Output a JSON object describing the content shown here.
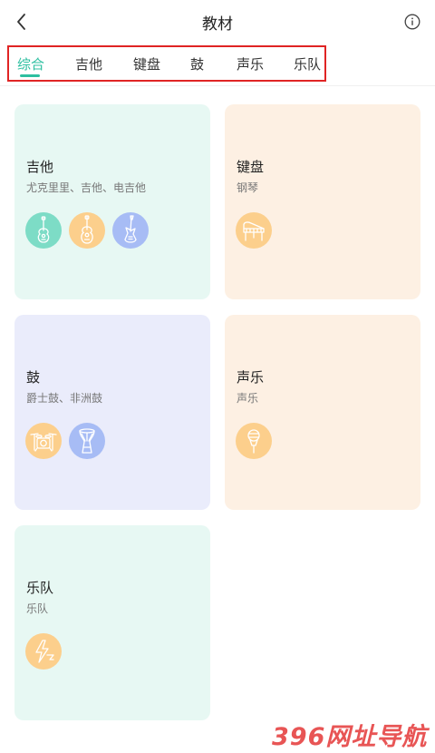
{
  "header": {
    "title": "教材",
    "back_icon": "chevron-left-icon",
    "info_icon": "info-circle-icon"
  },
  "tabs": [
    {
      "label": "综合",
      "active": true
    },
    {
      "label": "吉他",
      "active": false
    },
    {
      "label": "键盘",
      "active": false
    },
    {
      "label": "鼓",
      "active": false
    },
    {
      "label": "声乐",
      "active": false
    },
    {
      "label": "乐队",
      "active": false
    }
  ],
  "colors": {
    "accent": "#2dbfa0",
    "highlight_border": "#e02424",
    "mint_card": "#e7f8f3",
    "peach_card": "#fdf0e3",
    "lavender_card": "#eaecfb",
    "teal_icon": "#7ddcc6",
    "orange_icon": "#fccf8c",
    "blue_icon": "#a7bcf5"
  },
  "cards": [
    {
      "title": "吉他",
      "subtitle": "尤克里里、吉他、电吉他",
      "icons": [
        "ukulele-icon",
        "acoustic-guitar-icon",
        "electric-guitar-icon"
      ]
    },
    {
      "title": "键盘",
      "subtitle": "钢琴",
      "icons": [
        "piano-icon"
      ]
    },
    {
      "title": "鼓",
      "subtitle": "爵士鼓、非洲鼓",
      "icons": [
        "drum-kit-icon",
        "djembe-icon"
      ]
    },
    {
      "title": "声乐",
      "subtitle": "声乐",
      "icons": [
        "microphone-icon"
      ]
    },
    {
      "title": "乐队",
      "subtitle": "乐队",
      "icons": [
        "band-lightning-icon"
      ]
    }
  ],
  "watermark": "396网址导航"
}
